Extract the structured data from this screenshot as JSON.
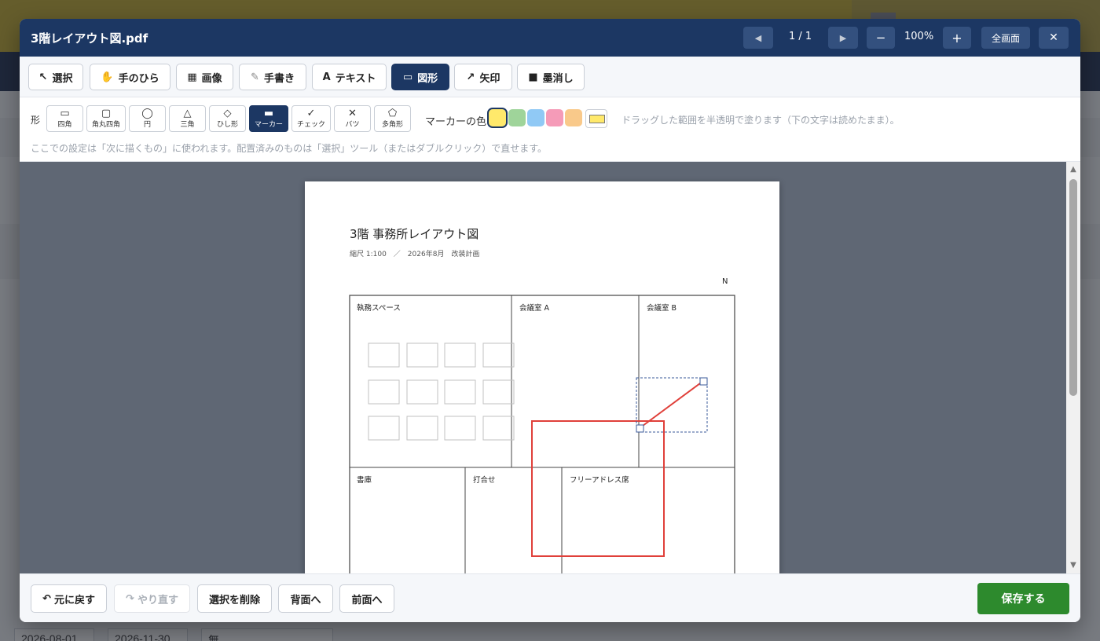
{
  "modal": {
    "title": "3階レイアウト図.pdf",
    "page_indicator": "1 / 1",
    "zoom": "100%",
    "fullscreen_label": "全画面",
    "prev_icon": "◀",
    "next_icon": "▶",
    "zoom_out_icon": "−",
    "zoom_in_icon": "+",
    "close_icon": "✕"
  },
  "tools": [
    {
      "icon": "↖",
      "label": "選択"
    },
    {
      "icon": "✋",
      "label": "手のひら"
    },
    {
      "icon": "▦",
      "label": "画像"
    },
    {
      "icon": "✎",
      "label": "手書き"
    },
    {
      "icon": "A",
      "label": "テキスト"
    },
    {
      "icon": "▭",
      "label": "図形",
      "active": true
    },
    {
      "icon": "↗",
      "label": "矢印"
    },
    {
      "icon": "■",
      "label": "墨消し"
    }
  ],
  "shape_options": {
    "label": "形",
    "items": [
      {
        "icon": "▭",
        "label": "四角"
      },
      {
        "icon": "▢",
        "label": "角丸四角"
      },
      {
        "icon": "◯",
        "label": "円"
      },
      {
        "icon": "△",
        "label": "三角"
      },
      {
        "icon": "◇",
        "label": "ひし形"
      },
      {
        "icon": "▬",
        "label": "マーカー",
        "active": true
      },
      {
        "icon": "✓",
        "label": "チェック"
      },
      {
        "icon": "✕",
        "label": "バツ"
      },
      {
        "icon": "⬠",
        "label": "多角形"
      }
    ],
    "marker_color_label": "マーカーの色",
    "marker_colors": [
      "#ffe96b",
      "#9fd49a",
      "#90c9f5",
      "#f59bb8",
      "#f9c98a"
    ],
    "selected_color_index": 0,
    "marker_hint": "ドラッグした範囲を半透明で塗ります（下の文字は読めたまま）。",
    "settings_hint": "ここでの設定は「次に描くもの」に使われます。配置済みのものは「選択」ツール（またはダブルクリック）で直せます。"
  },
  "document": {
    "heading": "3階 事務所レイアウト図",
    "subheading": "縮尺 1:100　／　2026年8月　改装計画",
    "north_mark": "N",
    "rooms": {
      "office": "執務スペース",
      "meeting_a": "会議室 A",
      "meeting_b": "会議室 B",
      "storage": "書庫",
      "huddle": "打合せ",
      "free_address": "フリーアドレス席"
    }
  },
  "footer": {
    "undo": "元に戻す",
    "redo": "やり直す",
    "delete_selection": "選択を削除",
    "send_back": "背面へ",
    "bring_front": "前面へ",
    "save": "保存する",
    "undo_icon": "↶",
    "redo_icon": "↷"
  },
  "background": {
    "dates": [
      "2026-08-01",
      "2026-11-30",
      "無"
    ]
  }
}
